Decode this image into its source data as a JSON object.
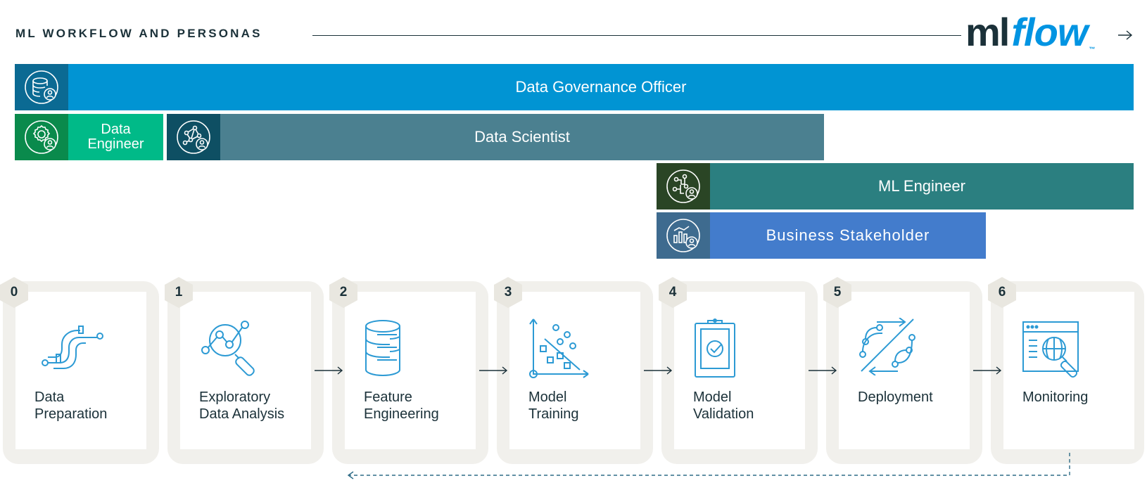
{
  "header": {
    "title": "ML WORKFLOW AND PERSONAS",
    "logo_ml": "ml",
    "logo_flow": "flow",
    "logo_tm": "™"
  },
  "personas": [
    {
      "label": "Data Governance Officer",
      "icon": "governance-icon",
      "color": "#0194d3",
      "icon_bg": "#0b6a93"
    },
    {
      "label": "Data Engineer",
      "icon": "gear-user-icon",
      "color": "#00ba88",
      "icon_bg": "#0a8a4c"
    },
    {
      "label": "Data Scientist",
      "icon": "network-user-icon",
      "color": "#4b8090",
      "icon_bg": "#0e4f63"
    },
    {
      "label": "ML Engineer",
      "icon": "circuit-user-icon",
      "color": "#2b7f80",
      "icon_bg": "#2a4525"
    },
    {
      "label": "Business Stakeholder",
      "icon": "chart-user-icon",
      "color": "#437ccc",
      "icon_bg": "#3e6b8f"
    }
  ],
  "steps": [
    {
      "number": "0",
      "line1": "Data",
      "line2": "Preparation",
      "icon": "pipes-icon"
    },
    {
      "number": "1",
      "line1": "Exploratory",
      "line2": "Data Analysis",
      "icon": "magnifier-graph-icon"
    },
    {
      "number": "2",
      "line1": "Feature",
      "line2": "Engineering",
      "icon": "database-icon"
    },
    {
      "number": "3",
      "line1": "Model",
      "line2": "Training",
      "icon": "scatter-plot-icon"
    },
    {
      "number": "4",
      "line1": "Model",
      "line2": "Validation",
      "icon": "clipboard-check-icon"
    },
    {
      "number": "5",
      "line1": "Deployment",
      "line2": "",
      "icon": "deploy-arrows-icon"
    },
    {
      "number": "6",
      "line1": "Monitoring",
      "line2": "",
      "icon": "monitor-browser-icon"
    }
  ],
  "colors": {
    "icon_stroke": "#2c9ad4",
    "text_dark": "#1b3139",
    "card_shadow": "#f1f0ec"
  }
}
